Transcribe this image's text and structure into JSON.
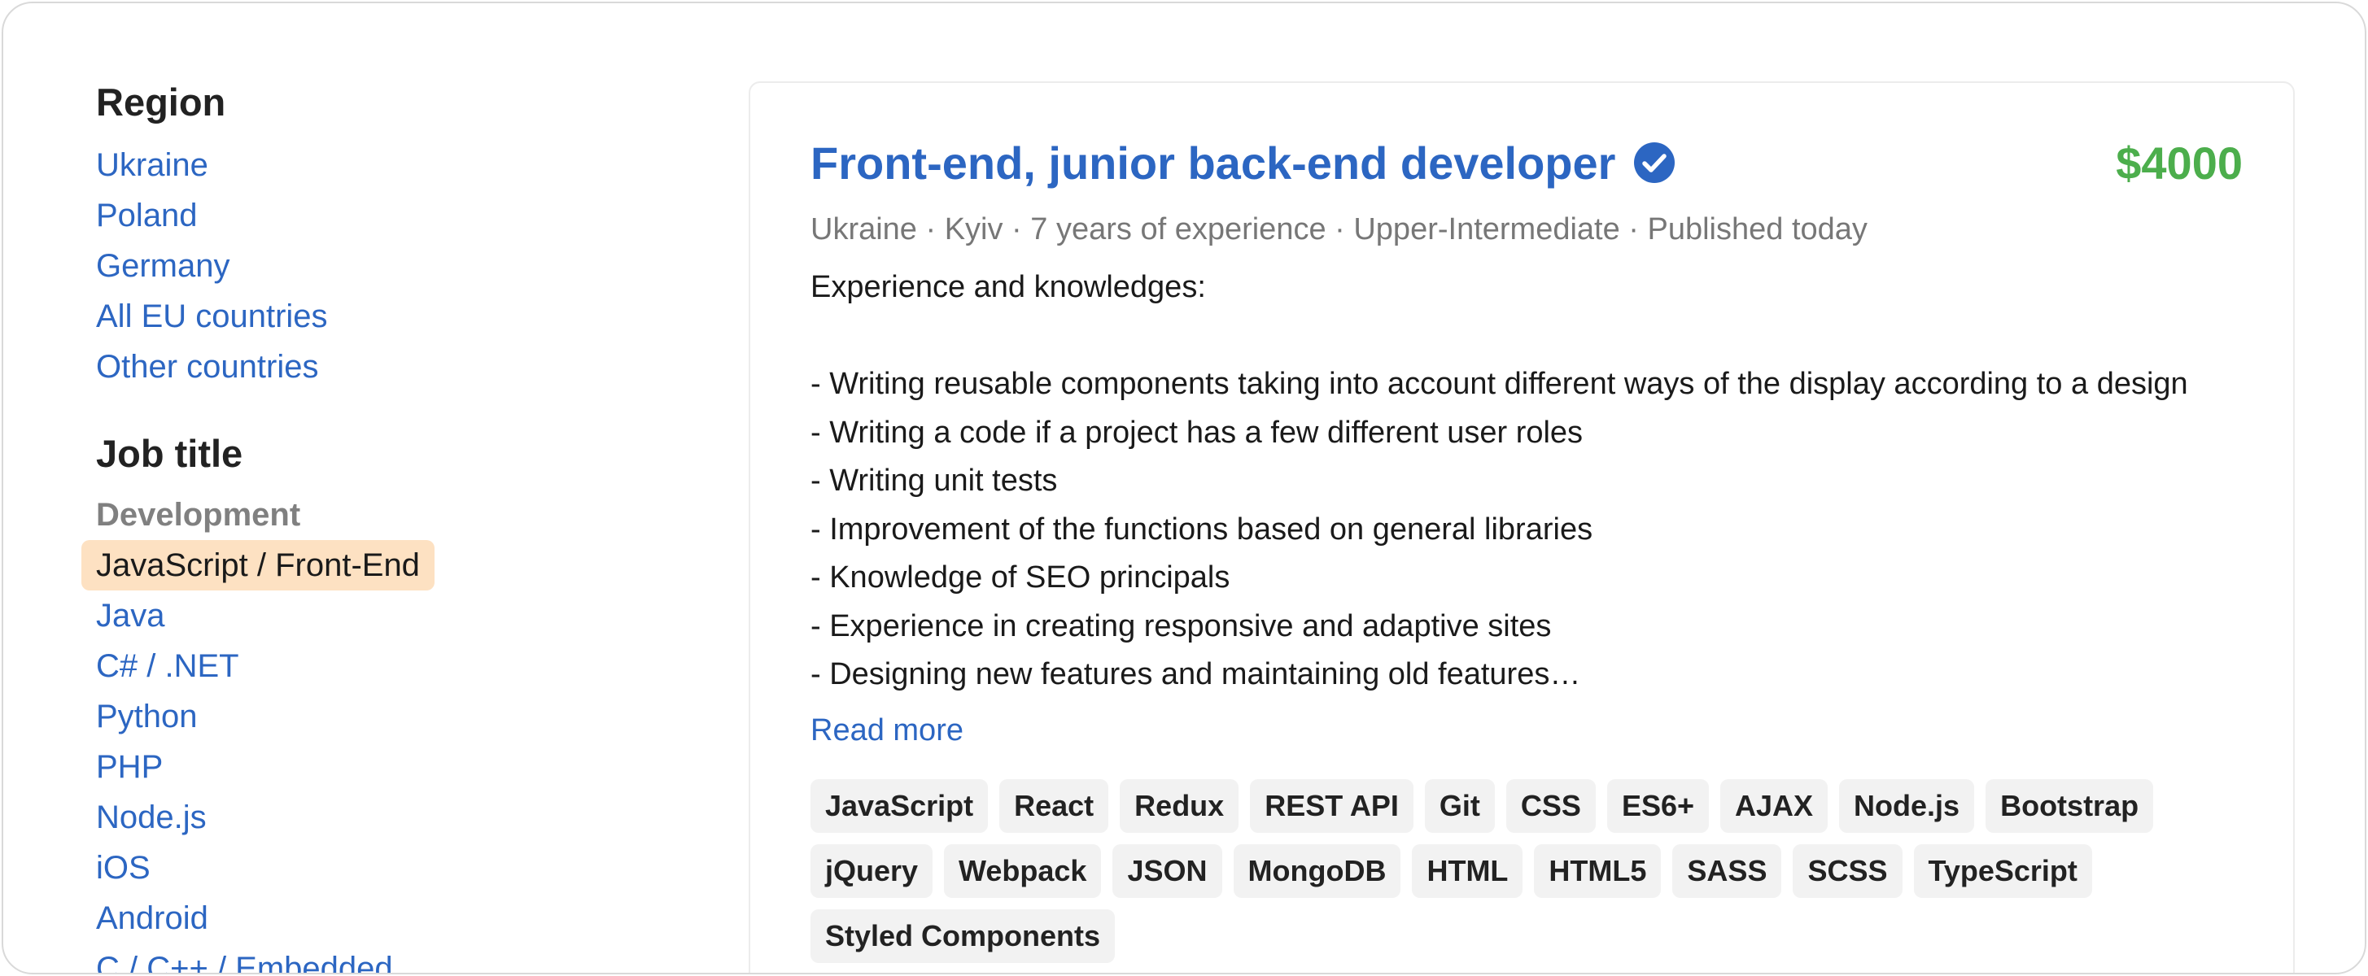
{
  "sidebar": {
    "region_title": "Region",
    "regions": [
      "Ukraine",
      "Poland",
      "Germany",
      "All EU countries",
      "Other countries"
    ],
    "job_title_heading": "Job title",
    "category": "Development",
    "selected_job": "JavaScript / Front-End",
    "jobs": [
      "Java",
      "C# / .NET",
      "Python",
      "PHP",
      "Node.js",
      "iOS",
      "Android",
      "C / C++ / Embedded"
    ]
  },
  "card": {
    "title": "Front-end, junior back-end developer",
    "verified_icon": "verified-check-icon",
    "salary": "$4000",
    "meta": "Ukraine · Kyiv · 7 years of experience · Upper-Intermediate · Published today",
    "description": {
      "intro": "Experience and knowledges:",
      "items": [
        "- Writing reusable components taking into account different ways of the display according to a design",
        "- Writing a code if a project has a few different user roles",
        "- Writing unit tests",
        "- Improvement of the functions based on general libraries",
        "- Knowledge of SEO principals",
        "- Experience in creating responsive and adaptive sites",
        "- Designing new features and maintaining old features…"
      ]
    },
    "read_more": "Read more",
    "tags": [
      "JavaScript",
      "React",
      "Redux",
      "REST API",
      "Git",
      "CSS",
      "ES6+",
      "AJAX",
      "Node.js",
      "Bootstrap",
      "jQuery",
      "Webpack",
      "JSON",
      "MongoDB",
      "HTML",
      "HTML5",
      "SASS",
      "SCSS",
      "TypeScript",
      "Styled Components"
    ]
  },
  "colors": {
    "link": "#2c66c2",
    "salary": "#4cae4c",
    "selected_bg": "#fde1c2",
    "tag_bg": "#f2f2f2"
  }
}
